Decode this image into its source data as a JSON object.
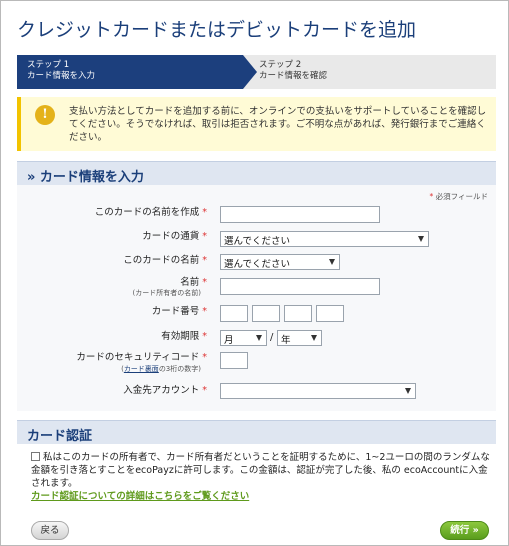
{
  "page": {
    "title": "クレジットカードまたはデビットカードを追加"
  },
  "steps": [
    {
      "number": "ステップ 1",
      "label": "カード情報を入力",
      "active": true
    },
    {
      "number": "ステップ 2",
      "label": "カード情報を確認",
      "active": false
    }
  ],
  "notice": {
    "icon": "info-icon",
    "icon_glyph": "!",
    "text": "支払い方法としてカードを追加する前に、オンラインでの支払いをサポートしていることを確認してください。そうでなければ、取引は拒否されます。ご不明な点があれば、発行銀行までご連絡ください。"
  },
  "card_section": {
    "heading": "» カード情報を入力",
    "required_note": "必須フィールド",
    "required_mark": "*",
    "fields": {
      "card_name_create": {
        "label": "このカードの名前を作成"
      },
      "currency": {
        "label": "カードの通貨",
        "selected": "選んでください"
      },
      "card_type": {
        "label": "このカードの名前",
        "selected": "選んでください"
      },
      "holder_name": {
        "label": "名前",
        "sub": "(カード所有者の名前)"
      },
      "card_number": {
        "label": "カード番号"
      },
      "expiry": {
        "label": "有効期限",
        "month_selected": "月",
        "year_selected": "年",
        "separator": "/"
      },
      "security_code": {
        "label": "カードのセキュリティコード",
        "sub_link": "カード裏面",
        "sub_open": "(",
        "sub_rest": "の3桁の数字)"
      },
      "deposit_account": {
        "label": "入金先アカウント",
        "selected": ""
      }
    }
  },
  "auth_section": {
    "heading": "カード認証",
    "consent_text": "私はこのカードの所有者で、カード所有者だということを証明するために、1~2ユーロの間のランダムな金額を引き落とすことをecoPayzに許可します。この金額は、認証が完了した後、私の ecoAccountに入金されます。",
    "more_link": "カード認証についての詳細はこちらをご覧ください"
  },
  "footer": {
    "back_label": "戻る",
    "next_label": "続行 »"
  },
  "colors": {
    "title": "#1b3f7a",
    "step_active": "#1c3f7d",
    "notice_bg": "#fffbd6",
    "link_green": "#5f9a1c",
    "next_button": "#6aac27"
  }
}
